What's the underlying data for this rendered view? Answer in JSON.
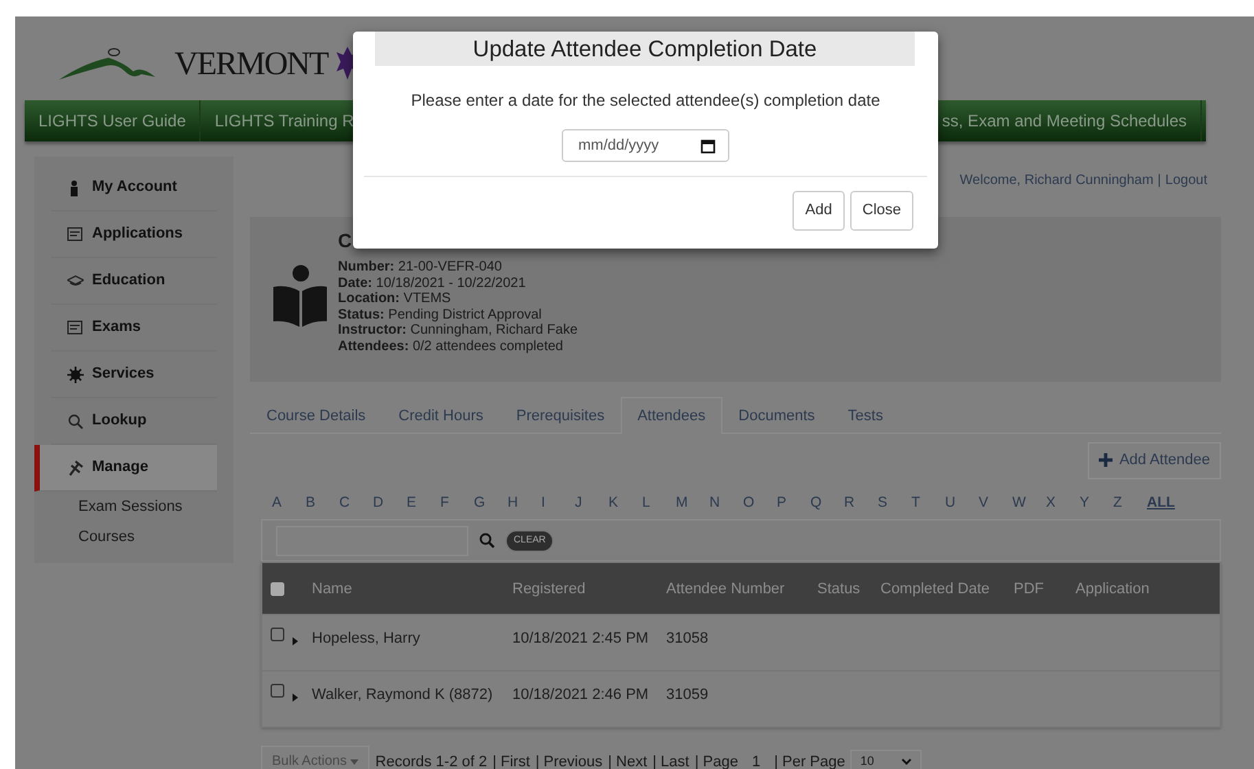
{
  "header": {
    "logo_text": "VERMONT",
    "nav": [
      {
        "label": "LIGHTS User Guide"
      },
      {
        "label": "LIGHTS Training R"
      },
      {
        "label": "ss, Exam and Meeting Schedules"
      }
    ],
    "welcome": "Welcome, Richard Cunningham",
    "separator": "|",
    "logout": "Logout"
  },
  "sidebar": {
    "items": [
      {
        "label": "My Account",
        "selected": false
      },
      {
        "label": "Applications",
        "selected": false
      },
      {
        "label": "Education",
        "selected": false
      },
      {
        "label": "Exams",
        "selected": false
      },
      {
        "label": "Services",
        "selected": false
      },
      {
        "label": "Lookup",
        "selected": false
      },
      {
        "label": "Manage",
        "selected": true,
        "children": [
          {
            "label": "Exam Sessions"
          },
          {
            "label": "Courses"
          }
        ]
      }
    ]
  },
  "course": {
    "title": "C",
    "details": [
      {
        "label": "Number:",
        "value": "21-00-VEFR-040"
      },
      {
        "label": "Date:",
        "value": "10/18/2021 - 10/22/2021"
      },
      {
        "label": "Location:",
        "value": "VTEMS"
      },
      {
        "label": "Status:",
        "value": "Pending District Approval"
      },
      {
        "label": "Instructor:",
        "value": "Cunningham, Richard Fake"
      },
      {
        "label": "Attendees:",
        "value": "0/2 attendees completed"
      }
    ]
  },
  "tabs": [
    {
      "label": "Course Details",
      "selected": false
    },
    {
      "label": "Credit Hours",
      "selected": false
    },
    {
      "label": "Prerequisites",
      "selected": false
    },
    {
      "label": "Attendees",
      "selected": true
    },
    {
      "label": "Documents",
      "selected": false
    },
    {
      "label": "Tests",
      "selected": false
    }
  ],
  "add_button": "Add Attendee",
  "letters": [
    {
      "label": "A",
      "selected": false
    },
    {
      "label": "B",
      "selected": false
    },
    {
      "label": "C",
      "selected": false
    },
    {
      "label": "D",
      "selected": false
    },
    {
      "label": "E",
      "selected": false
    },
    {
      "label": "F",
      "selected": false
    },
    {
      "label": "G",
      "selected": false
    },
    {
      "label": "H",
      "selected": false
    },
    {
      "label": "I",
      "selected": false
    },
    {
      "label": "J",
      "selected": false
    },
    {
      "label": "K",
      "selected": false
    },
    {
      "label": "L",
      "selected": false
    },
    {
      "label": "M",
      "selected": false
    },
    {
      "label": "N",
      "selected": false
    },
    {
      "label": "O",
      "selected": false
    },
    {
      "label": "P",
      "selected": false
    },
    {
      "label": "Q",
      "selected": false
    },
    {
      "label": "R",
      "selected": false
    },
    {
      "label": "S",
      "selected": false
    },
    {
      "label": "T",
      "selected": false
    },
    {
      "label": "U",
      "selected": false
    },
    {
      "label": "V",
      "selected": false
    },
    {
      "label": "W",
      "selected": false
    },
    {
      "label": "X",
      "selected": false
    },
    {
      "label": "Y",
      "selected": false
    },
    {
      "label": "Z",
      "selected": false
    },
    {
      "label": "ALL",
      "selected": true
    }
  ],
  "search": {
    "clear": "CLEAR"
  },
  "table": {
    "select_all_checked": false,
    "columns": [
      "Name",
      "Registered",
      "Attendee Number",
      "Status",
      "Completed Date",
      "PDF",
      "Application"
    ],
    "rows": [
      {
        "checked": false,
        "name": "Hopeless, Harry",
        "registered": "10/18/2021 2:45 PM",
        "number": "31058"
      },
      {
        "checked": false,
        "name": "Walker, Raymond K (8872)",
        "registered": "10/18/2021 2:46 PM",
        "number": "31059"
      }
    ]
  },
  "pager": {
    "bulk": "Bulk Actions",
    "records": "Records 1-2 of 2",
    "links": [
      "| First",
      "| Previous",
      "| Next",
      "| Last"
    ],
    "page_label": "| Page",
    "page": "1",
    "per_page_label": "| Per Page",
    "per_page": "10"
  },
  "modal": {
    "title": "Update Attendee Completion Date",
    "message": "Please enter a date for the selected attendee(s) completion date",
    "date_placeholder": "mm/dd/yyyy",
    "buttons": [
      "Add",
      "Close"
    ]
  }
}
